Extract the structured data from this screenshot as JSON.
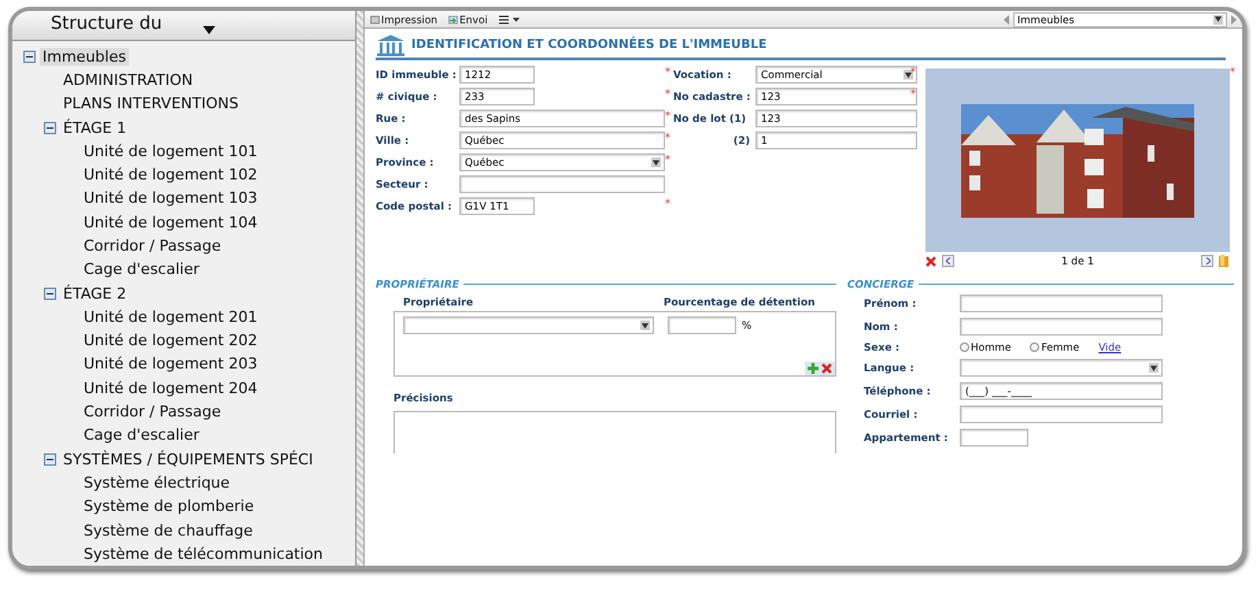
{
  "sidebar": {
    "header": "Structure du",
    "tree": [
      {
        "label": "Immeubles",
        "selected": true,
        "expanded": true,
        "children": [
          {
            "label": "ADMINISTRATION",
            "selected": false
          },
          {
            "label": "PLANS INTERVENTIONS",
            "selected": false
          },
          {
            "label": "ÉTAGE 1",
            "selected": false,
            "expanded": true,
            "children": [
              {
                "label": "Unité de logement 101",
                "selected": false
              },
              {
                "label": "Unité de logement 102",
                "selected": false
              },
              {
                "label": "Unité de logement 103",
                "selected": false
              },
              {
                "label": "Unité de logement 104",
                "selected": false
              },
              {
                "label": "Corridor / Passage",
                "selected": false
              },
              {
                "label": "Cage d'escalier",
                "selected": false
              }
            ]
          },
          {
            "label": "ÉTAGE 2",
            "selected": false,
            "expanded": true,
            "children": [
              {
                "label": "Unité de logement 201",
                "selected": false
              },
              {
                "label": "Unité de logement 202",
                "selected": false
              },
              {
                "label": "Unité de logement 203",
                "selected": false
              },
              {
                "label": "Unité de logement 204",
                "selected": false
              },
              {
                "label": "Corridor / Passage",
                "selected": false
              },
              {
                "label": "Cage d'escalier",
                "selected": false
              }
            ]
          },
          {
            "label": "SYSTÈMES / ÉQUIPEMENTS SPÉCI",
            "selected": false,
            "expanded": true,
            "children": [
              {
                "label": "Système électrique",
                "selected": false
              },
              {
                "label": "Système de plomberie",
                "selected": false
              },
              {
                "label": "Système de chauffage",
                "selected": false
              },
              {
                "label": "Système de télécommunication",
                "selected": false
              }
            ]
          }
        ]
      }
    ]
  },
  "toolbar": {
    "buttons": [
      "Impression",
      "Envoi"
    ],
    "navigator": "Immeubles"
  },
  "section_title": "IDENTIFICATION ET COORDONNÉES DE L'IMMEUBLE",
  "identification": [
    {
      "label": "ID immeuble :",
      "value": "1212",
      "kind": "short",
      "mark": "*"
    },
    {
      "label": "# civique :",
      "value": "233",
      "kind": "short",
      "mark": "*"
    },
    {
      "label": "Rue :",
      "value": "des Sapins",
      "kind": "text",
      "mark": "*"
    },
    {
      "label": "Ville :",
      "value": "Québec",
      "kind": "text",
      "mark": "*"
    },
    {
      "label": "Province :",
      "value": "Québec",
      "kind": "select",
      "mark": "*"
    },
    {
      "label": "Secteur :",
      "kind": "text"
    },
    {
      "label": "Code postal :",
      "value": "G1V 1T1",
      "kind": "short",
      "mark": "*"
    }
  ],
  "property": [
    {
      "label": "Vocation :",
      "value": "Commercial",
      "kind": "select",
      "mark": "*"
    },
    {
      "label": "No cadastre :",
      "value": "123",
      "kind": "text",
      "mark": "*"
    },
    {
      "label": "No de lot (1)",
      "value": "123",
      "kind": "text"
    },
    {
      "label": "(2)",
      "value": "1",
      "kind": "text"
    }
  ],
  "photo": {
    "kind": "picture",
    "pager": "1 de 1",
    "mark": "*"
  },
  "owner": {
    "title": "PROPRIÉTAIRE",
    "columns": [
      "Propriétaire",
      "Pourcentage de détention"
    ],
    "unit": "%",
    "notes_label": "Précisions"
  },
  "concierge": {
    "title": "CONCIERGE",
    "fields": [
      {
        "label": "Prénom :",
        "kind": "text"
      },
      {
        "label": "Nom :",
        "kind": "text"
      },
      {
        "label": "Sexe :",
        "kind": "radio",
        "options": [
          {
            "label": "Homme",
            "selected": false
          },
          {
            "label": "Femme",
            "selected": false
          }
        ],
        "link": "Vide"
      },
      {
        "label": "Langue :",
        "kind": "select"
      },
      {
        "label": "Téléphone :",
        "kind": "text",
        "value": "(___) ___-____"
      },
      {
        "label": "Courriel :",
        "kind": "text"
      },
      {
        "label": "Appartement :",
        "kind": "short"
      }
    ]
  }
}
